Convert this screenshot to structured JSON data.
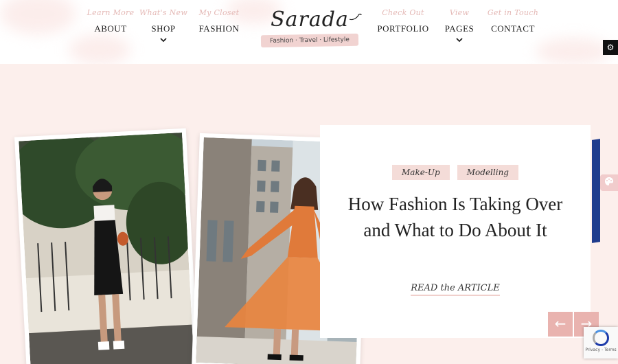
{
  "nav_left": [
    {
      "sub": "Learn More",
      "label": "ABOUT",
      "dropdown": false
    },
    {
      "sub": "What's New",
      "label": "SHOP",
      "dropdown": true
    },
    {
      "sub": "My Closet",
      "label": "FASHION",
      "dropdown": false
    }
  ],
  "nav_right": [
    {
      "sub": "Check Out",
      "label": "PORTFOLIO",
      "dropdown": false
    },
    {
      "sub": "View",
      "label": "PAGES",
      "dropdown": true
    },
    {
      "sub": "Get in Touch",
      "label": "CONTACT",
      "dropdown": false
    }
  ],
  "logo": {
    "name": "Sarada",
    "tagline": "Fashion · Travel · Lifestyle"
  },
  "hero": {
    "tags": [
      "Make-Up",
      "Modelling"
    ],
    "title": "How Fashion Is Taking Over and What to Do About It",
    "cta": "READ the ARTICLE"
  },
  "controls": {
    "prev_icon": "arrow-left-icon",
    "next_icon": "arrow-right-icon",
    "settings_icon": "gear-icon",
    "palette_icon": "palette-icon"
  },
  "recaptcha": {
    "text": "Privacy - Terms"
  },
  "colors": {
    "accent": "#e9b3af",
    "hero_bg": "#fcefec",
    "tag_bg": "#f4dcd8",
    "nav_sub": "#e4b8b5"
  }
}
